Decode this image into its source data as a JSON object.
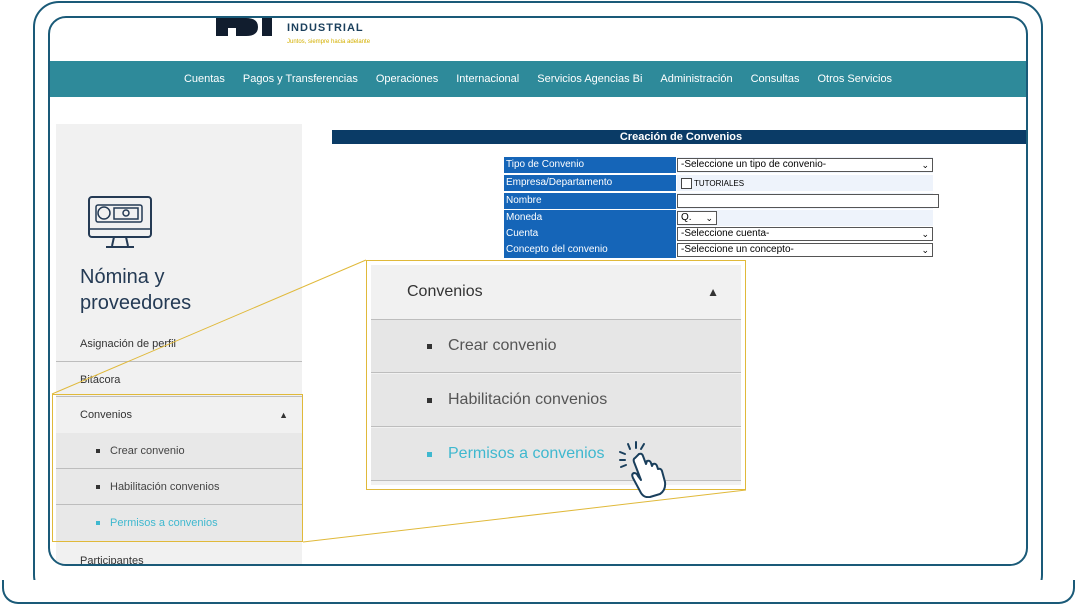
{
  "brand": {
    "logo_letters": "BI",
    "name": "INDUSTRIAL",
    "tagline": "Juntos, siempre hacia adelante"
  },
  "nav": {
    "items": [
      "Cuentas",
      "Pagos y Transferencias",
      "Operaciones",
      "Internacional",
      "Servicios Agencias Bi",
      "Administración",
      "Consultas",
      "Otros Servicios"
    ]
  },
  "sidebar": {
    "title_line1": "Nómina y",
    "title_line2": "proveedores",
    "items": [
      "Asignación de perfil",
      "Bitácora",
      "Convenios",
      "Participantes"
    ],
    "convenios_submenu": [
      "Crear convenio",
      "Habilitación convenios",
      "Permisos a convenios"
    ]
  },
  "form": {
    "header": "Creación de Convenios",
    "labels": [
      "Tipo de Convenio",
      "Empresa/Departamento",
      "Nombre",
      "Moneda",
      "Cuenta",
      "Concepto del convenio"
    ],
    "tipo_convenio_value": "-Seleccione un tipo de convenio-",
    "empresa_checkbox_label": "TUTORIALES",
    "nombre_value": "",
    "moneda_value": "Q.",
    "cuenta_value": "-Seleccione cuenta-",
    "concepto_value": "-Seleccione un concepto-"
  },
  "zoom": {
    "title": "Convenios",
    "items": [
      "Crear convenio",
      "Habilitación convenios",
      "Permisos a convenios"
    ]
  },
  "colors": {
    "navbar": "#2e8a9a",
    "accent": "#3fb8cf",
    "callout": "#e0b93a",
    "form_header": "#0a3b66",
    "label_bg": "#1565b8"
  }
}
